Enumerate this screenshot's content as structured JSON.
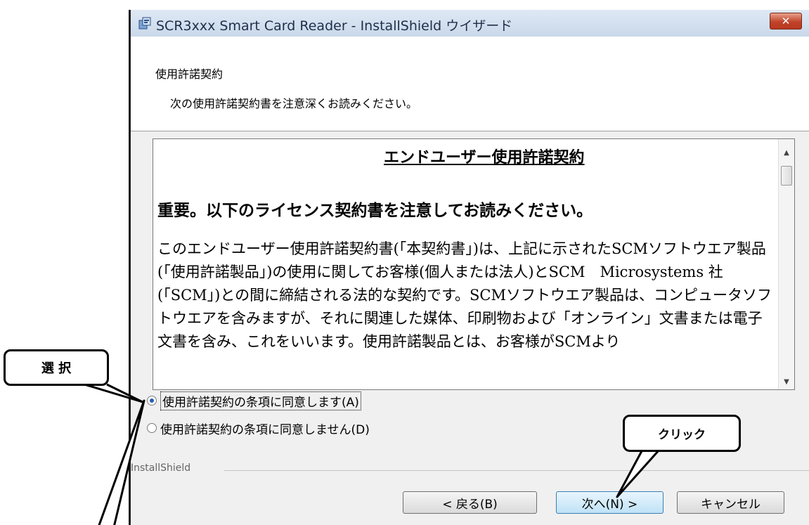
{
  "window": {
    "title": "SCR3xxx Smart Card Reader - InstallShield ウイザード",
    "close_label": "✕"
  },
  "header": {
    "title": "使用許諾契約",
    "subtitle": "次の使用許諾契約書を注意深くお読みください。"
  },
  "license": {
    "title": "エンドユーザー使用許諾契約",
    "important": "重要。以下のライセンス契約書を注意してお読みください。",
    "body": "このエンドユーザー使用許諾契約書(「本契約書」)は、上記に示されたSCMソフトウエア製品(「使用許諾製品」)の使用に関してお客様(個人または法人)とSCM　Microsystems 社(「SCM」)との間に締結される法的な契約です。SCMソフトウエア製品は、コンピュータソフトウエアを含みますが、それに関連した媒体、印刷物および「オンライン」文書または電子文書を含み、これをいいます。使用許諾製品とは、お客様がSCMより"
  },
  "options": {
    "accept": "使用許諾契約の条項に同意します(A)",
    "decline": "使用許諾契約の条項に同意しません(D)",
    "selected": "accept"
  },
  "footer": {
    "brand": "InstallShield"
  },
  "buttons": {
    "back": "< 戻る(B)",
    "next": "次へ(N) >",
    "cancel": "キャンセル"
  },
  "annotations": {
    "select": "選 択",
    "click": "クリック"
  },
  "icons": {
    "app": "installer-icon",
    "close": "close-icon"
  }
}
